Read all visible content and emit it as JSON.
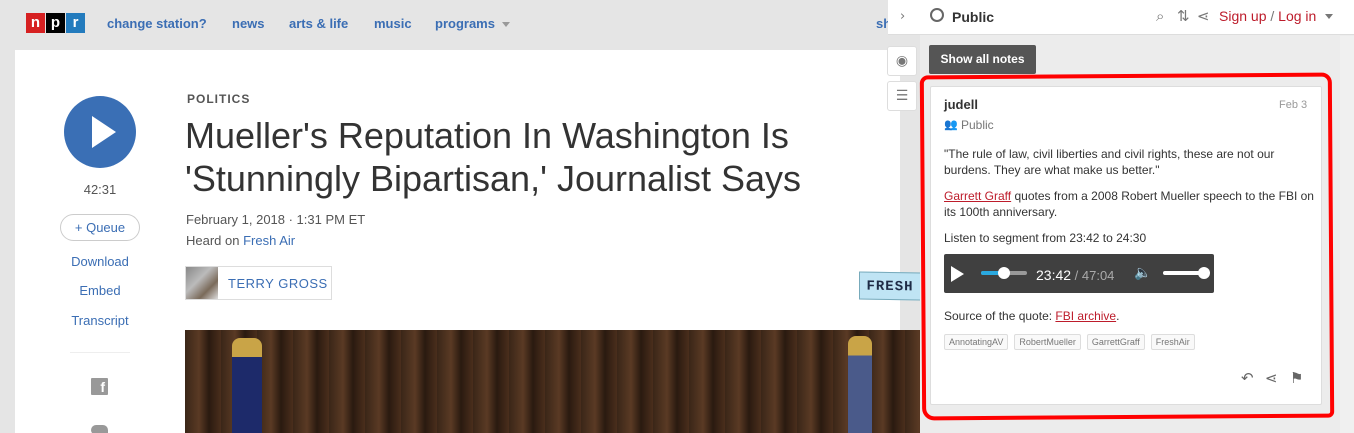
{
  "npr": {
    "logo_letters": [
      "n",
      "p",
      "r"
    ],
    "nav": [
      "change station?",
      "news",
      "arts & life",
      "music",
      "programs"
    ],
    "nav_overflow": "sh"
  },
  "rail": {
    "duration": "42:31",
    "queue_label": "+ Queue",
    "links": [
      "Download",
      "Embed",
      "Transcript"
    ],
    "facebook_glyph": "f"
  },
  "article": {
    "section": "POLITICS",
    "headline": "Mueller's Reputation In Washington Is 'Stunningly Bipartisan,' Journalist Says",
    "date": "February 1, 2018 · 1:31 PM ET",
    "heard_on_prefix": "Heard on ",
    "heard_on_show": "Fresh Air",
    "byline": "TERRY GROSS",
    "fresh_logo": "FRESH"
  },
  "sidebar": {
    "group": "Public",
    "signup": "Sign up",
    "separator": " / ",
    "login": "Log in",
    "show_all_notes": "Show all notes",
    "icons": {
      "chevron": "›",
      "search": "⌕",
      "sort": "⇅",
      "share": "⋖",
      "eye": "◉",
      "notes": "☰"
    },
    "annotation": {
      "user": "judell",
      "date": "Feb 3",
      "scope": "Public",
      "quote": "\"The rule of law, civil liberties and civil rights, these are not our burdens. They are what make us better.\"",
      "link_name": "Garrett Graff",
      "body_rest": " quotes from a 2008 Robert Mueller speech to the FBI on its 100th anniversary.",
      "segment": "Listen to segment from 23:42 to 24:30",
      "audio": {
        "current": "23:42",
        "total": " / 47:04",
        "progress": 0.5,
        "volume": 1.0
      },
      "source_prefix": "Source of the quote: ",
      "source_link": "FBI archive",
      "source_suffix": ".",
      "tags": [
        "AnnotatingAV",
        "RobertMueller",
        "GarrettGraff",
        "FreshAir"
      ],
      "actions": {
        "reply": "↶",
        "share": "⋖",
        "flag": "⚑"
      }
    }
  },
  "colors": {
    "npr_blue": "#3b6eb4",
    "hypothesis_red": "#bd1c2b",
    "highlight": "#ff0000"
  }
}
